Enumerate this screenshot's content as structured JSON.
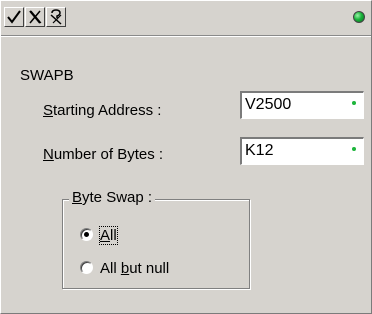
{
  "toolbar": {
    "buttons": [
      {
        "icon": "checkmark-icon"
      },
      {
        "icon": "cancel-icon"
      },
      {
        "icon": "help-icon"
      }
    ],
    "status_color": "#19b33a"
  },
  "instruction": "SWAPB",
  "fields": {
    "starting_address": {
      "label": "Starting Address :",
      "value": "V2500"
    },
    "number_of_bytes": {
      "label": "Number of Bytes :",
      "value": "K12"
    }
  },
  "byte_swap": {
    "legend": "Byte Swap :",
    "options": [
      {
        "label": "All",
        "selected": true
      },
      {
        "label": "All but null",
        "selected": false
      }
    ]
  }
}
